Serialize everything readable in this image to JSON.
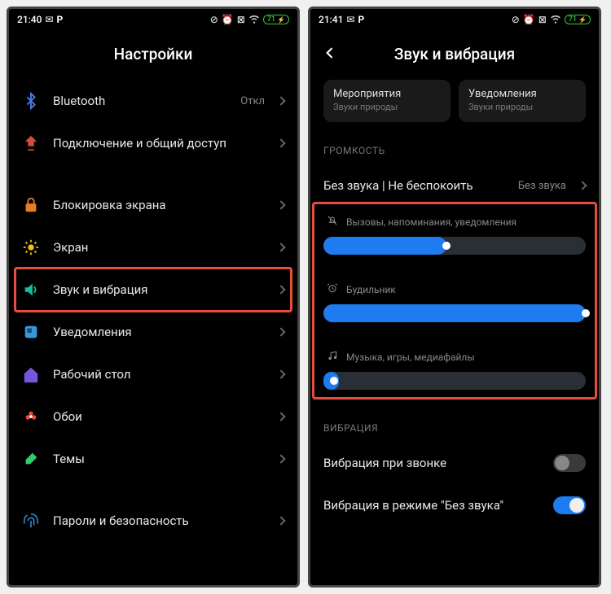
{
  "left": {
    "time": "21:40",
    "battery": "71",
    "title": "Настройки",
    "items": [
      {
        "label": "Bluetooth",
        "value": "Откл",
        "icon": "bluetooth-icon",
        "color": "#4a7de8"
      },
      {
        "label": "Подключение и общий доступ",
        "icon": "share-icon",
        "color": "#d64d3c"
      }
    ],
    "items2": [
      {
        "label": "Блокировка экрана",
        "icon": "lock-icon",
        "color": "#e67e22"
      },
      {
        "label": "Экран",
        "icon": "sun-icon",
        "color": "#f1c40f"
      },
      {
        "label": "Звук и вибрация",
        "icon": "speaker-icon",
        "color": "#1abc9c",
        "highlight": true
      },
      {
        "label": "Уведомления",
        "icon": "notification-icon",
        "color": "#3498db"
      },
      {
        "label": "Рабочий стол",
        "icon": "home-icon",
        "color": "#7755dd"
      },
      {
        "label": "Обои",
        "icon": "flower-icon",
        "color": "#e74c3c"
      },
      {
        "label": "Темы",
        "icon": "brush-icon",
        "color": "#2ecc71"
      }
    ],
    "items3": [
      {
        "label": "Пароли и безопасность",
        "icon": "fingerprint-icon",
        "color": "#3498db"
      }
    ]
  },
  "right": {
    "time": "21:41",
    "battery": "71",
    "title": "Звук и вибрация",
    "tiles": [
      {
        "title": "Мероприятия",
        "sub": "Звуки природы"
      },
      {
        "title": "Уведомления",
        "sub": "Звуки природы"
      }
    ],
    "volume_section": "ГРОМКОСТЬ",
    "silent_row": {
      "label": "Без звука | Не беспокоить",
      "value": "Без звука"
    },
    "sliders": [
      {
        "label": "Вызовы, напоминания, уведомления",
        "icon": "bell-off-icon",
        "percent": 47
      },
      {
        "label": "Будильник",
        "icon": "alarm-icon",
        "percent": 100
      },
      {
        "label": "Музыка, игры, медиафайлы",
        "icon": "music-icon",
        "percent": 4
      }
    ],
    "vibration_section": "ВИБРАЦИЯ",
    "vib1": {
      "label": "Вибрация при звонке",
      "on": false
    },
    "vib2": {
      "label": "Вибрация в режиме \"Без звука\"",
      "on": true
    }
  }
}
